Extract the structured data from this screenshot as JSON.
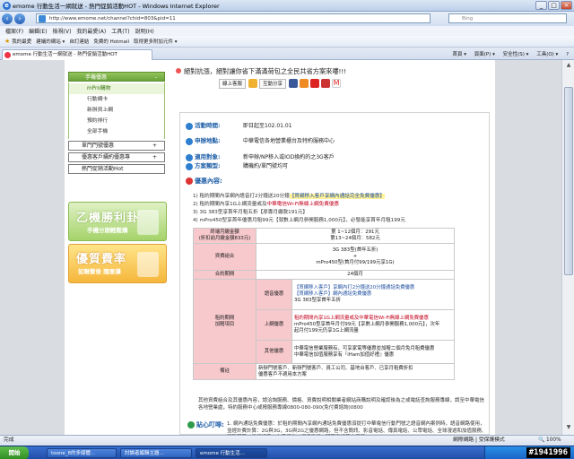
{
  "window": {
    "title": "emome 行動生活一網就送 - 熱門促銷活動HOT - Windows Internet Explorer",
    "min": "_",
    "max": "□",
    "close": "×"
  },
  "address": {
    "url": "http://www.emome.net/channel?chid=803&pid=11",
    "search_placeholder": "Bing"
  },
  "menu": [
    "檔案(F)",
    "編輯(E)",
    "檢視(V)",
    "我的最愛(A)",
    "工具(T)",
    "說明(H)"
  ],
  "favorites": {
    "label": "我的最愛",
    "items": [
      "建議的網站 ▾",
      "自訂連結",
      "免費的 Hotmail",
      "取得更多附加元件 ▾"
    ]
  },
  "tab": {
    "title": "emome 行動生活一網就送 - 熱門促銷活動HOT",
    "tools": [
      "首頁 ▾",
      "頁面(P) ▾",
      "安全性(S) ▾",
      "工具(O) ▾",
      "?"
    ]
  },
  "sidebar": {
    "head1": "手機優惠",
    "sub": [
      "mPro購物",
      "行動網卡",
      "新辦資上網",
      "預約排行",
      "全部手機"
    ],
    "head2": "單門門號優惠",
    "head3": "優惠客戶續約優惠專",
    "head4": "熱門促銷活動Hot",
    "plus": "+",
    "minus": "-"
  },
  "banners": {
    "b1_title": "乙機勝利卦",
    "b1_sub": "手機分期輕鬆購",
    "b2_title": "優質費率",
    "b2_sub": "如聯繫後 隨意講"
  },
  "promo": "絕對抗漲，絕對讓你省下滿滿荷包之全民共省方案來嘍!!!",
  "share": {
    "b1": "線上客服",
    "b2": "互動分享"
  },
  "main": {
    "period_label": "活動時間:",
    "period_value": "即日起至102.01.01",
    "apply_label": "申辦地點:",
    "apply_value": "中華電信各地營業櫃台及特約服務中心",
    "target_label": "適用對象:",
    "target_value": "新申辦/NP移入或IOD換約的之3G客戶",
    "type_label": "方案類型:",
    "type_value": "購機約/單門號均可",
    "offer_title": "優惠內容:",
    "o1_pre": "1) 租約期間內享網內語音打2分鐘送20分鐘",
    "o1_hl": "【貫網移入客戶享網內通話完全免費優惠】",
    "o2_pre": "2) 租約期間內享1G上網流量或及",
    "o2_red": "中華電信Wi-Fi無線上網免費優惠",
    "o3": "3) 3G 383型享首年月租五折【原專月繳款191元】",
    "o4": "4) mPro450型享首年優惠月租99元【就數上網月參開服務1,000元】，必發能享首年月租199元",
    "table": {
      "r1c1": "終端月繳金額\n(折扣前月繳金額833元)",
      "r1c2a": "第 1~12個月：291元",
      "r1c2b": "第13~24個月：582元",
      "r2c1": "資費組合",
      "r2c2a": "3G 383型(首年五折)",
      "r2c2b": "+",
      "r2c2c": "mPro450型(首月付99/199元享1G)",
      "r3c1": "合約期間",
      "r3c2": "24個月",
      "r4c1": "租約期間\n加贈項目",
      "voice": "語音優惠",
      "v1": "【貫網移入客戶】享網內打2分鐘送20分鐘通話免費優惠",
      "v2": "【貫網移入客戶】網內通話免費優惠",
      "v3": "3G 383型享首年五折",
      "net": "上網優惠",
      "n1": "租約期間內享1G上網流量或及中華電信Wi-Fi無線上網免費優惠",
      "n2": "mPro450型享首年月付99元【享數上網月參開服務1,000元】，次年",
      "n3": "起月付199元仍享1G上網流量",
      "other": "其他優惠",
      "t1": "中華電信營業服務有，可享家電等優惠並加贈二個月免月租費優惠",
      "t2": "中華電信加值服務享有『iHam加值好禮』優惠",
      "r5c1": "備註",
      "r5c2a": "新辦門號客戶、新辦門號客戶、員工公司、基地台客戶、已享月租費折扣",
      "r5c2b": "優惠客戶不適用本方案"
    },
    "footnote": "其他資費組合及其優惠內容，請洽詢服務、價格、資費說明相關業者網站商購說明及確認後為之或電話查詢服務專線，請至中華電信各地營業處，特約服務中心或撥服務專線0800-080-090(免付費諮詢)0800",
    "kind_title": "貼心叮嚀:",
    "kind_text": "1. 網內通話免費優惠：於租約期間內享網內通話免費優惠須提打中華電信行動門號之語音網內案例時，語音網路使用，並經計費計算：2G與3G，3G與2G之優惠網路，但不含簡訊、影音電話、傳真電話、公眾電話、全球漫遊和加值服務、特殊服務、電話語音、大量播放、視訊電話、國際電話等之費用"
  },
  "status": {
    "left": "完成",
    "zone": "網際網路 | 受保護模式",
    "zoom": "🔍 100%"
  },
  "taskbar": {
    "start": "開始",
    "tasks": [
      "toone_8的多媒體...",
      "討論者編輯主題...",
      "emome 行動生活..."
    ],
    "watermark": "#1941996"
  }
}
